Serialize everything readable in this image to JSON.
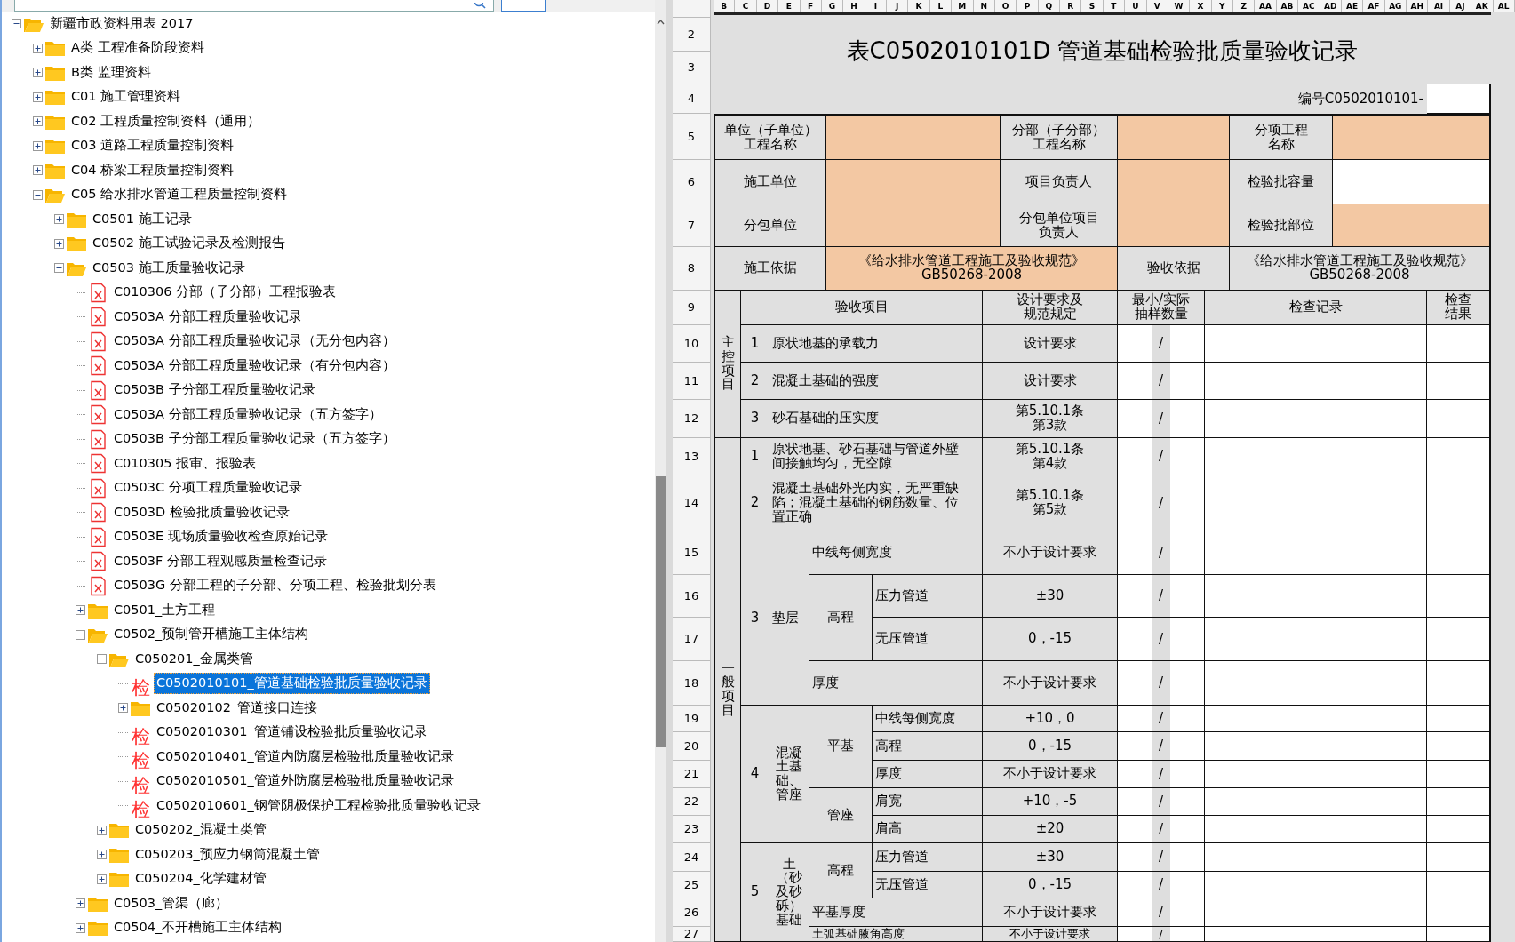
{
  "tree": {
    "label": "新疆市政资料用表 2017",
    "kind": "folder",
    "expanded": true,
    "selected": false,
    "children": [
      {
        "label": "A类 工程准备阶段资料",
        "kind": "folder",
        "expanded": false,
        "selected": false
      },
      {
        "label": "B类 监理资料",
        "kind": "folder",
        "expanded": false,
        "selected": false
      },
      {
        "label": "C01 施工管理资料",
        "kind": "folder",
        "expanded": false,
        "selected": false
      },
      {
        "label": "C02 工程质量控制资料（通用）",
        "kind": "folder",
        "expanded": false,
        "selected": false
      },
      {
        "label": "C03 道路工程质量控制资料",
        "kind": "folder",
        "expanded": false,
        "selected": false
      },
      {
        "label": "C04 桥梁工程质量控制资料",
        "kind": "folder",
        "expanded": false,
        "selected": false
      },
      {
        "label": "C05 给水排水管道工程质量控制资料",
        "kind": "folder",
        "expanded": true,
        "selected": false,
        "children": [
          {
            "label": "C0501 施工记录",
            "kind": "folder",
            "expanded": false,
            "selected": false
          },
          {
            "label": "C0502 施工试验记录及检测报告",
            "kind": "folder",
            "expanded": false,
            "selected": false
          },
          {
            "label": "C0503 施工质量验收记录",
            "kind": "folder",
            "expanded": true,
            "selected": false,
            "children": [
              {
                "label": "C010306 分部（子分部）工程报验表",
                "kind": "sheet",
                "selected": false
              },
              {
                "label": "C0503A 分部工程质量验收记录",
                "kind": "sheet",
                "selected": false
              },
              {
                "label": "C0503A 分部工程质量验收记录（无分包内容）",
                "kind": "sheet",
                "selected": false
              },
              {
                "label": "C0503A 分部工程质量验收记录（有分包内容）",
                "kind": "sheet",
                "selected": false
              },
              {
                "label": "C0503B 子分部工程质量验收记录",
                "kind": "sheet",
                "selected": false
              },
              {
                "label": "C0503A 分部工程质量验收记录（五方签字）",
                "kind": "sheet",
                "selected": false
              },
              {
                "label": "C0503B 子分部工程质量验收记录（五方签字）",
                "kind": "sheet",
                "selected": false
              },
              {
                "label": "C010305 报审、报验表",
                "kind": "sheet",
                "selected": false
              },
              {
                "label": "C0503C 分项工程质量验收记录",
                "kind": "sheet",
                "selected": false
              },
              {
                "label": "C0503D 检验批质量验收记录",
                "kind": "sheet",
                "selected": false
              },
              {
                "label": "C0503E 现场质量验收检查原始记录",
                "kind": "sheet",
                "selected": false
              },
              {
                "label": "C0503F 分部工程观感质量检查记录",
                "kind": "sheet",
                "selected": false
              },
              {
                "label": "C0503G 分部工程的子分部、分项工程、检验批划分表",
                "kind": "sheet",
                "selected": false
              },
              {
                "label": "C0501_土方工程",
                "kind": "folder",
                "expanded": false,
                "selected": false
              },
              {
                "label": "C0502_预制管开槽施工主体结构",
                "kind": "folder",
                "expanded": true,
                "selected": false,
                "children": [
                  {
                    "label": "C050201_金属类管",
                    "kind": "folder",
                    "expanded": true,
                    "selected": false,
                    "children": [
                      {
                        "label": "C0502010101_管道基础检验批质量验收记录",
                        "kind": "form",
                        "badge": "检",
                        "selected": true
                      },
                      {
                        "label": "C05020102_管道接口连接",
                        "kind": "folder",
                        "expanded": false,
                        "selected": false
                      },
                      {
                        "label": "C0502010301_管道铺设检验批质量验收记录",
                        "kind": "form",
                        "badge": "检",
                        "selected": false
                      },
                      {
                        "label": "C0502010401_管道内防腐层检验批质量验收记录",
                        "kind": "form",
                        "badge": "检",
                        "selected": false
                      },
                      {
                        "label": "C0502010501_管道外防腐层检验批质量验收记录",
                        "kind": "form",
                        "badge": "检",
                        "selected": false
                      },
                      {
                        "label": "C0502010601_钢管阴极保护工程检验批质量验收记录",
                        "kind": "form",
                        "badge": "检",
                        "selected": false
                      }
                    ]
                  },
                  {
                    "label": "C050202_混凝土类管",
                    "kind": "folder",
                    "expanded": false,
                    "selected": false
                  },
                  {
                    "label": "C050203_预应力钢筒混凝土管",
                    "kind": "folder",
                    "expanded": false,
                    "selected": false
                  },
                  {
                    "label": "C050204_化学建材管",
                    "kind": "folder",
                    "expanded": false,
                    "selected": false
                  }
                ]
              },
              {
                "label": "C0503_管渠（廊）",
                "kind": "folder",
                "expanded": false,
                "selected": false
              },
              {
                "label": "C0504_不开槽施工主体结构",
                "kind": "folder",
                "expanded": false,
                "selected": false
              }
            ]
          }
        ]
      }
    ]
  },
  "sheet": {
    "column_headers": [
      "B",
      "C",
      "D",
      "E",
      "F",
      "G",
      "H",
      "I",
      "J",
      "K",
      "L",
      "M",
      "N",
      "O",
      "P",
      "Q",
      "R",
      "S",
      "T",
      "U",
      "V",
      "W",
      "X",
      "Y",
      "Z",
      "AA",
      "AB",
      "AC",
      "AD",
      "AE",
      "AF",
      "AG",
      "AH",
      "AI",
      "AJ",
      "AK",
      "AL"
    ],
    "row_numbers": [
      "2",
      "3",
      "4",
      "5",
      "6",
      "7",
      "8",
      "9",
      "10",
      "11",
      "12",
      "13",
      "14",
      "15",
      "16",
      "17",
      "18",
      "19",
      "20",
      "21",
      "22",
      "23",
      "24",
      "25",
      "26",
      "27"
    ],
    "cells": [
      {
        "kind": "title",
        "text": "表C0502010101D 管道基础检验批质量验收记录"
      },
      {
        "kind": "number",
        "text": "编号C0502010101-"
      },
      {
        "kind": "blank"
      },
      {
        "kind": "label",
        "text": "单位（子单位）工程名称"
      },
      {
        "kind": "fill"
      },
      {
        "kind": "label",
        "text": "分部（子分部）工程名称"
      },
      {
        "kind": "fill"
      },
      {
        "kind": "label",
        "text": "分项工程名称"
      },
      {
        "kind": "fill"
      },
      {
        "kind": "label",
        "text": "施工单位"
      },
      {
        "kind": "fill"
      },
      {
        "kind": "label",
        "text": "项目负责人"
      },
      {
        "kind": "fill"
      },
      {
        "kind": "label",
        "text": "检验批容量"
      },
      {
        "kind": "blank"
      },
      {
        "kind": "label",
        "text": "分包单位"
      },
      {
        "kind": "fill"
      },
      {
        "kind": "label",
        "text": "分包单位项目负责人"
      },
      {
        "kind": "fill"
      },
      {
        "kind": "label",
        "text": "检验批部位"
      },
      {
        "kind": "fill"
      },
      {
        "kind": "label",
        "text": "施工依据"
      },
      {
        "kind": "fill",
        "text": "《给水排水管道工程施工及验收规范》\nGB50268-2008"
      },
      {
        "kind": "label",
        "text": "验收依据"
      },
      {
        "kind": "label",
        "text": "《给水排水管道工程施工及验收规范》\nGB50268-2008"
      },
      {
        "kind": "label",
        "text": "主控项目"
      },
      {
        "kind": "label",
        "text": "验收项目"
      },
      {
        "kind": "label",
        "text": "设计要求及规范规定"
      },
      {
        "kind": "label",
        "text": "最小/实际抽样数量"
      },
      {
        "kind": "label",
        "text": "检查记录"
      },
      {
        "kind": "label",
        "text": "检查结果"
      },
      {
        "kind": "label",
        "text": "1"
      },
      {
        "kind": "label",
        "text": "原状地基的承载力"
      },
      {
        "kind": "label",
        "text": "设计要求"
      },
      {
        "kind": "label",
        "text": "2"
      },
      {
        "kind": "label",
        "text": "混凝土基础的强度"
      },
      {
        "kind": "label",
        "text": "设计要求"
      },
      {
        "kind": "label",
        "text": "3"
      },
      {
        "kind": "label",
        "text": "砂石基础的压实度"
      },
      {
        "kind": "label",
        "text": "第5.10.1条第3款"
      },
      {
        "kind": "label",
        "text": "一般项目"
      },
      {
        "kind": "label",
        "text": "1"
      },
      {
        "kind": "label",
        "text": "原状地基、砂石基础与管道外壁间接触均匀，无空隙"
      },
      {
        "kind": "label",
        "text": "第5.10.1条第4款"
      },
      {
        "kind": "label",
        "text": "2"
      },
      {
        "kind": "label",
        "text": "混凝土基础外光内实，无严重缺陷；混凝土基础的钢筋数量、位置正确"
      },
      {
        "kind": "label",
        "text": "第5.10.1条第5款"
      },
      {
        "kind": "label",
        "text": "3"
      },
      {
        "kind": "label",
        "text": "垫层"
      },
      {
        "kind": "label",
        "text": "中线每侧宽度"
      },
      {
        "kind": "label",
        "text": "不小于设计要求"
      },
      {
        "kind": "label",
        "text": "高程"
      },
      {
        "kind": "label",
        "text": "压力管道"
      },
      {
        "kind": "label",
        "text": "±30"
      },
      {
        "kind": "label",
        "text": "无压管道"
      },
      {
        "kind": "label",
        "text": "0，-15"
      },
      {
        "kind": "label",
        "text": "厚度"
      },
      {
        "kind": "label",
        "text": "不小于设计要求"
      },
      {
        "kind": "label",
        "text": "4"
      },
      {
        "kind": "label",
        "text": "混凝土基础、管座"
      },
      {
        "kind": "label",
        "text": "平基"
      },
      {
        "kind": "label",
        "text": "中线每侧宽度"
      },
      {
        "kind": "label",
        "text": "+10，0"
      },
      {
        "kind": "label",
        "text": "高程"
      },
      {
        "kind": "label",
        "text": "0，-15"
      },
      {
        "kind": "label",
        "text": "厚度"
      },
      {
        "kind": "label",
        "text": "不小于设计要求"
      },
      {
        "kind": "label",
        "text": "管座"
      },
      {
        "kind": "label",
        "text": "肩宽"
      },
      {
        "kind": "label",
        "text": "+10，-5"
      },
      {
        "kind": "label",
        "text": "肩高"
      },
      {
        "kind": "label",
        "text": "±20"
      },
      {
        "kind": "label",
        "text": "5"
      },
      {
        "kind": "label",
        "text": "土（砂及砂砾）基础"
      },
      {
        "kind": "label",
        "text": "高程"
      },
      {
        "kind": "label",
        "text": "压力管道"
      },
      {
        "kind": "label",
        "text": "±30"
      },
      {
        "kind": "label",
        "text": "无压管道"
      },
      {
        "kind": "label",
        "text": "0，-15"
      },
      {
        "kind": "label",
        "text": "平基厚度"
      },
      {
        "kind": "label",
        "text": "不小于设计要求"
      },
      {
        "kind": "label",
        "text": "土弧基础腋角高度"
      },
      {
        "kind": "label",
        "text": "不小于设计要求"
      }
    ],
    "sample_marks": [
      "/",
      "/",
      "/",
      "/",
      "/",
      "/",
      "/",
      "/",
      "/",
      "/",
      "/",
      "/",
      "/",
      "/",
      "/",
      "/",
      "/",
      "/"
    ]
  }
}
